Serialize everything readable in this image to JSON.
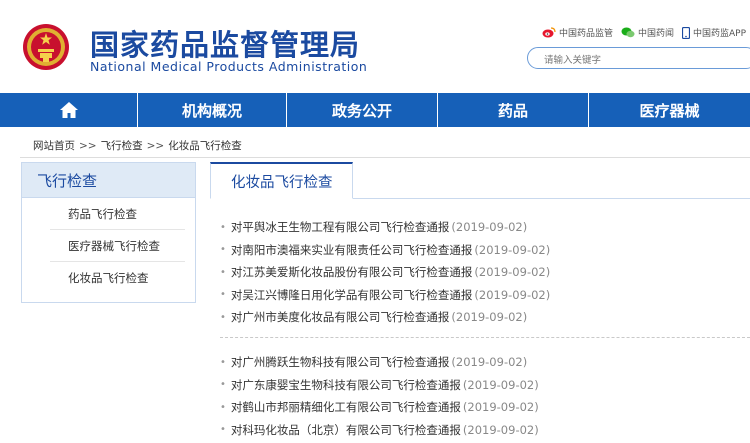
{
  "header": {
    "title_cn": "国家药品监督管理局",
    "title_en": "National Medical Products Administration",
    "emblem": "national-emblem",
    "links": [
      {
        "label": "中国药品监管",
        "icon": "weibo-icon"
      },
      {
        "label": "中国药闻",
        "icon": "wechat-icon"
      },
      {
        "label": "中国药监APP",
        "icon": "phone-icon"
      }
    ],
    "search_placeholder": "请输入关键字"
  },
  "nav": {
    "home_icon": "home-icon",
    "items": [
      "机构概况",
      "政务公开",
      "药品",
      "医疗器械"
    ]
  },
  "breadcrumb": {
    "items": [
      "网站首页",
      "飞行检查",
      "化妆品飞行检查"
    ],
    "sep": ">>"
  },
  "sidebar": {
    "title": "飞行检查",
    "items": [
      "药品飞行检查",
      "医疗器械飞行检查",
      "化妆品飞行检查"
    ]
  },
  "main": {
    "tab": "化妆品飞行检查",
    "group1": [
      {
        "title": "对平舆冰王生物工程有限公司飞行检查通报",
        "date": "(2019-09-02)"
      },
      {
        "title": "对南阳市澳福来实业有限责任公司飞行检查通报",
        "date": "(2019-09-02)"
      },
      {
        "title": "对江苏美爱斯化妆品股份有限公司飞行检查通报",
        "date": "(2019-09-02)"
      },
      {
        "title": "对吴江兴博隆日用化学品有限公司飞行检查通报",
        "date": "(2019-09-02)"
      },
      {
        "title": "对广州市美度化妆品有限公司飞行检查通报",
        "date": "(2019-09-02)"
      }
    ],
    "group2": [
      {
        "title": "对广州腾跃生物科技有限公司飞行检查通报",
        "date": "(2019-09-02)"
      },
      {
        "title": "对广东康婴宝生物科技有限公司飞行检查通报",
        "date": "(2019-09-02)"
      },
      {
        "title": "对鹤山市邦丽精细化工有限公司飞行检查通报",
        "date": "(2019-09-02)"
      },
      {
        "title": "对科玛化妆品（北京）有限公司飞行检查通报",
        "date": "(2019-09-02)"
      }
    ]
  },
  "colors": {
    "brand": "#1b4aa0",
    "nav_bg": "#1660b8",
    "sidebar_bg": "#dfeaf6"
  }
}
